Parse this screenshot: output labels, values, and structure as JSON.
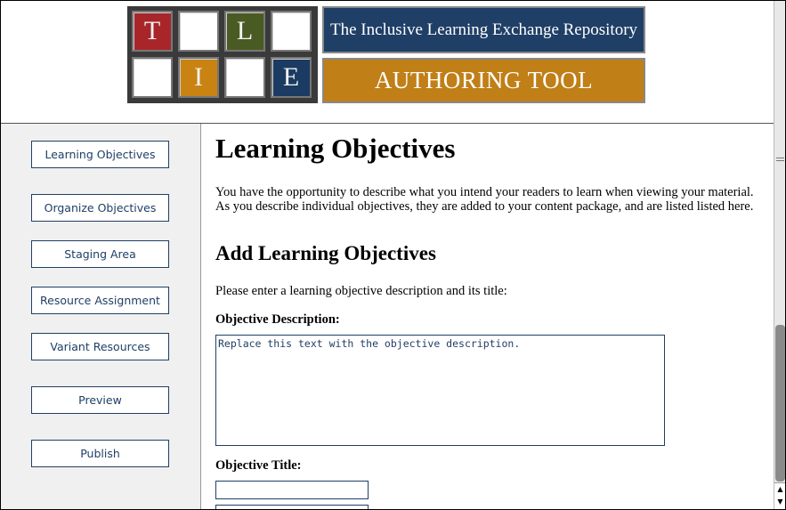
{
  "header": {
    "tiles": [
      "T",
      "",
      "L",
      "",
      "",
      "I",
      "",
      "E"
    ],
    "banner_top": "The Inclusive Learning Exchange Repository",
    "banner_bottom": "AUTHORING TOOL",
    "colors": {
      "red": "#a8262a",
      "olive": "#4a5a23",
      "orange": "#c98312",
      "navy": "#1b3b62"
    }
  },
  "sidebar": {
    "items": [
      {
        "label": "Learning Objectives"
      },
      {
        "label": "Organize Objectives"
      },
      {
        "label": "Staging Area"
      },
      {
        "label": "Resource Assignment"
      },
      {
        "label": "Variant Resources"
      },
      {
        "label": "Preview"
      },
      {
        "label": "Publish"
      }
    ]
  },
  "main": {
    "title": "Learning Objectives",
    "intro": "You have the opportunity to describe what you intend your readers to learn when viewing your material. As you describe individual objectives, they are added to your content package, and are listed listed here.",
    "section_title": "Add Learning Objectives",
    "prompt": "Please enter a learning objective description and its title:",
    "description_label": "Objective Description:",
    "description_value": "Replace this text with the objective description.",
    "title_label": "Objective Title:",
    "title_value": ""
  }
}
